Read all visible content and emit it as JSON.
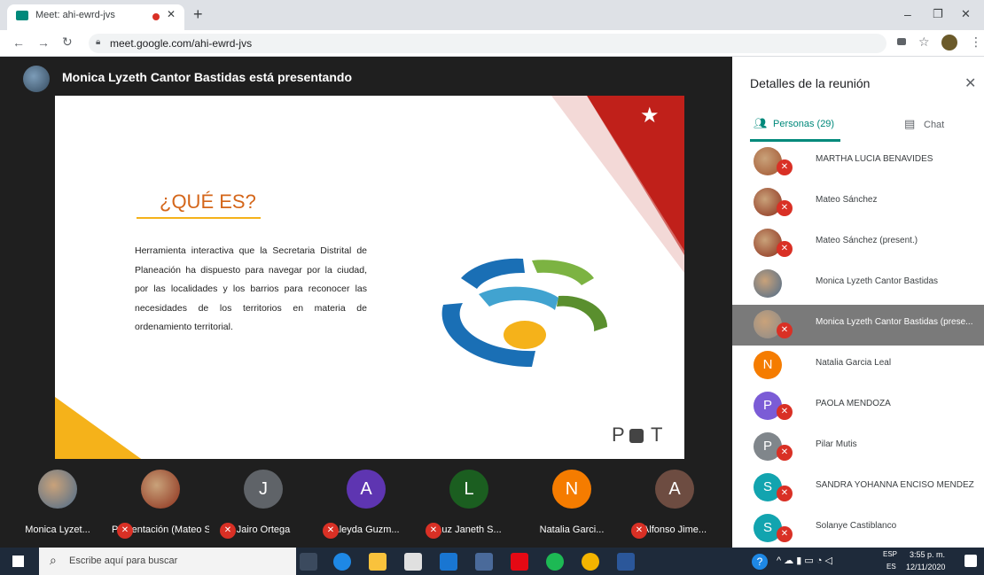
{
  "browser": {
    "tab_title": "Meet: ahi-ewrd-jvs",
    "new_tab_label": "+",
    "url": "meet.google.com/ahi-ewrd-jvs",
    "window_controls": {
      "minimize": "–",
      "maximize": "❐",
      "close": "✕"
    }
  },
  "presenter_banner": "Monica Lyzeth Cantor Bastidas está presentando",
  "slide": {
    "heading": "¿QUÉ ES?",
    "body": "Herramienta interactiva que la Secretaria Distrital de Planeación ha dispuesto para navegar por la ciudad, por las localidades y los barrios para reconocer las necesidades de los territorios en materia de ordenamiento territorial.",
    "logo_left": "P",
    "logo_right": "T"
  },
  "panel": {
    "title": "Detalles de la reunión",
    "tab_people": "Personas (29)",
    "tab_chat": "Chat",
    "participants": [
      {
        "name": "MARTHA LUCIA BENAVIDES",
        "avatar": "photo",
        "color": "#a0522d",
        "muted": true
      },
      {
        "name": "Mateo Sánchez",
        "avatar": "photo",
        "color": "#8b2e1a",
        "muted": true
      },
      {
        "name": "Mateo Sánchez (present.)",
        "avatar": "photo",
        "color": "#8b2e1a",
        "muted": true
      },
      {
        "name": "Monica Lyzeth Cantor Bastidas",
        "avatar": "photo",
        "color": "#4a6a8a",
        "muted": false
      },
      {
        "name": "Monica Lyzeth Cantor Bastidas (prese...",
        "avatar": "photo",
        "color": "#8a8a8a",
        "muted": true,
        "highlight": true
      },
      {
        "name": "Natalia Garcia Leal",
        "avatar": "N",
        "color": "#f57c00",
        "muted": false
      },
      {
        "name": "PAOLA MENDOZA",
        "avatar": "P",
        "color": "#7b5cd6",
        "muted": true
      },
      {
        "name": "Pilar Mutis",
        "avatar": "P",
        "color": "#80868b",
        "muted": true
      },
      {
        "name": "SANDRA YOHANNA ENCISO MENDEZ",
        "avatar": "S",
        "color": "#12a4af",
        "muted": true
      },
      {
        "name": "Solanye Castiblanco",
        "avatar": "S",
        "color": "#12a4af",
        "muted": true
      }
    ]
  },
  "tiles": [
    {
      "name": "Monica Lyzet...",
      "avatar": "photo",
      "color": "#4a6a8a",
      "muted": false
    },
    {
      "name": "Presentación (Mateo Sánc...",
      "avatar": "photo",
      "color": "#8b2e1a",
      "muted": true
    },
    {
      "name": "Jairo Ortega",
      "avatar": "J",
      "color": "#5f6368",
      "muted": true
    },
    {
      "name": "Aleyda Guzm...",
      "avatar": "A",
      "color": "#5e35b1",
      "muted": true
    },
    {
      "name": "Luz Janeth S...",
      "avatar": "L",
      "color": "#1b5e20",
      "muted": true
    },
    {
      "name": "Natalia Garci...",
      "avatar": "N",
      "color": "#f57c00",
      "muted": false
    },
    {
      "name": "Alfonso Jime...",
      "avatar": "A",
      "color": "#6d4c41",
      "muted": true
    }
  ],
  "taskbar": {
    "search_placeholder": "Escribe aquí para buscar",
    "lang_top": "ESP",
    "lang_bottom": "ES",
    "time": "3:55 p. m.",
    "date": "12/11/2020"
  }
}
